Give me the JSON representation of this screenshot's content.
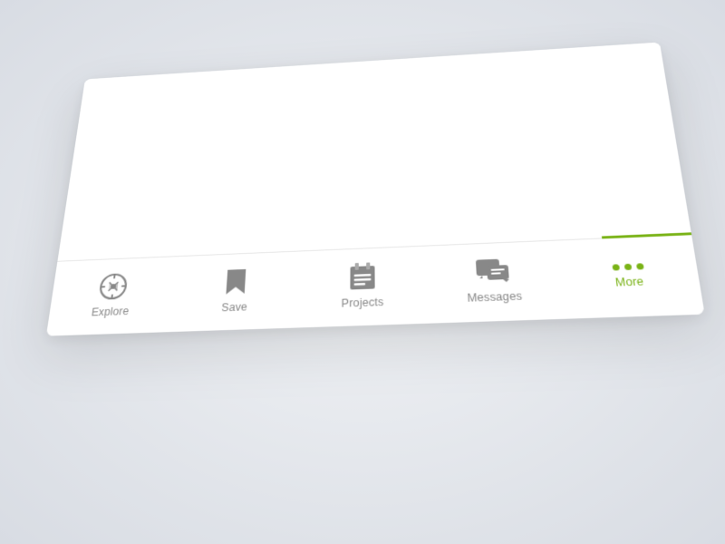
{
  "tabs": [
    {
      "id": "explore",
      "label": "Explore",
      "icon": "compass-icon",
      "active": false
    },
    {
      "id": "save",
      "label": "Save",
      "icon": "bookmark-icon",
      "active": false
    },
    {
      "id": "projects",
      "label": "Projects",
      "icon": "projects-icon",
      "active": false
    },
    {
      "id": "messages",
      "label": "Messages",
      "icon": "messages-icon",
      "active": false
    },
    {
      "id": "more",
      "label": "More",
      "icon": "more-icon",
      "active": true
    }
  ],
  "colors": {
    "active": "#7ab317",
    "inactive": "#888888",
    "dividerAccent": "#7ab317"
  }
}
